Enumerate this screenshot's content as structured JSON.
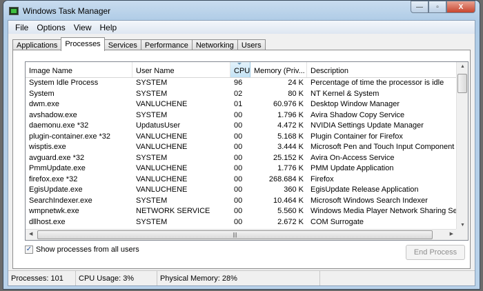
{
  "window": {
    "title": "Windows Task Manager",
    "minimize": "—",
    "maximize": "▫",
    "close": "X"
  },
  "menu": [
    "File",
    "Options",
    "View",
    "Help"
  ],
  "tabs": [
    "Applications",
    "Processes",
    "Services",
    "Performance",
    "Networking",
    "Users"
  ],
  "columns": [
    "Image Name",
    "User Name",
    "CPU",
    "Memory (Priv...",
    "Description"
  ],
  "rows": [
    [
      "System Idle Process",
      "SYSTEM",
      "96",
      "24 K",
      "Percentage of time the processor is idle"
    ],
    [
      "System",
      "SYSTEM",
      "02",
      "80 K",
      "NT Kernel & System"
    ],
    [
      "dwm.exe",
      "VANLUCHENE",
      "01",
      "60.976 K",
      "Desktop Window Manager"
    ],
    [
      "avshadow.exe",
      "SYSTEM",
      "00",
      "1.796 K",
      "Avira Shadow Copy Service"
    ],
    [
      "daemonu.exe *32",
      "UpdatusUser",
      "00",
      "4.472 K",
      "NVIDIA Settings Update Manager"
    ],
    [
      "plugin-container.exe *32",
      "VANLUCHENE",
      "00",
      "5.168 K",
      "Plugin Container for Firefox"
    ],
    [
      "wisptis.exe",
      "VANLUCHENE",
      "00",
      "3.444 K",
      "Microsoft Pen and Touch Input Component"
    ],
    [
      "avguard.exe *32",
      "SYSTEM",
      "00",
      "25.152 K",
      "Avira On-Access Service"
    ],
    [
      "PmmUpdate.exe",
      "VANLUCHENE",
      "00",
      "1.776 K",
      "PMM Update Application"
    ],
    [
      "firefox.exe *32",
      "VANLUCHENE",
      "00",
      "268.684 K",
      "Firefox"
    ],
    [
      "EgisUpdate.exe",
      "VANLUCHENE",
      "00",
      "360 K",
      "EgisUpdate Release Application"
    ],
    [
      "SearchIndexer.exe",
      "SYSTEM",
      "00",
      "10.464 K",
      "Microsoft Windows Search Indexer"
    ],
    [
      "wmpnetwk.exe",
      "NETWORK SERVICE",
      "00",
      "5.560 K",
      "Windows Media Player Network Sharing Service"
    ],
    [
      "dllhost.exe",
      "SYSTEM",
      "00",
      "2.672 K",
      "COM Surrogate"
    ]
  ],
  "show_all_users": {
    "label": "Show processes from all users",
    "checked": true
  },
  "end_process": "End Process",
  "status": {
    "processes": "Processes: 101",
    "cpu": "CPU Usage: 3%",
    "memory": "Physical Memory: 28%"
  }
}
